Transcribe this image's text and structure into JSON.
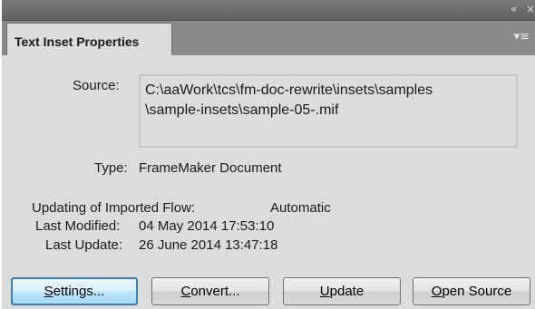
{
  "window": {
    "collapse_icon": "double-chevron-left-icon",
    "close_icon": "close-icon"
  },
  "tab": {
    "label": "Text Inset Properties",
    "menu_icon": "panel-menu-icon"
  },
  "source": {
    "label": "Source:",
    "value_line1": "C:\\aaWork\\tcs\\fm-doc-rewrite\\insets\\samples",
    "value_line2": "\\sample-insets\\sample-05-.mif"
  },
  "type": {
    "label": "Type:",
    "value": "FrameMaker Document"
  },
  "updating": {
    "label": "Updating of Imported Flow:",
    "value": "Automatic"
  },
  "last_modified": {
    "label": "Last Modified:",
    "value": "04 May 2014 17:53:10"
  },
  "last_update": {
    "label": "Last Update:",
    "value": "26 June 2014 13:47:18"
  },
  "buttons": {
    "settings": {
      "mnemonic": "S",
      "rest": "ettings..."
    },
    "convert": {
      "mnemonic": "C",
      "rest": "onvert..."
    },
    "update": {
      "mnemonic": "U",
      "rest": "pdate"
    },
    "open_source": {
      "mnemonic": "O",
      "rest": "pen Source"
    }
  },
  "colors": {
    "panel_bg": "#dcdcdc",
    "default_button_border": "#3c7fb1"
  }
}
